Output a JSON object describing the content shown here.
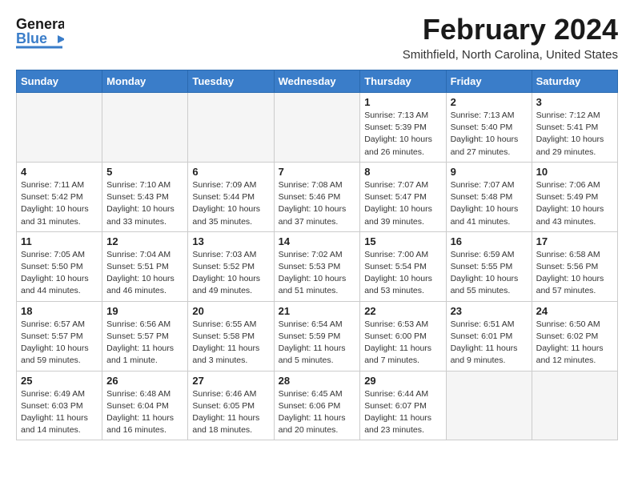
{
  "header": {
    "logo_line1": "General",
    "logo_line2": "Blue",
    "main_title": "February 2024",
    "subtitle": "Smithfield, North Carolina, United States"
  },
  "calendar": {
    "days_of_week": [
      "Sunday",
      "Monday",
      "Tuesday",
      "Wednesday",
      "Thursday",
      "Friday",
      "Saturday"
    ],
    "weeks": [
      [
        {
          "num": "",
          "info": ""
        },
        {
          "num": "",
          "info": ""
        },
        {
          "num": "",
          "info": ""
        },
        {
          "num": "",
          "info": ""
        },
        {
          "num": "1",
          "info": "Sunrise: 7:13 AM\nSunset: 5:39 PM\nDaylight: 10 hours\nand 26 minutes."
        },
        {
          "num": "2",
          "info": "Sunrise: 7:13 AM\nSunset: 5:40 PM\nDaylight: 10 hours\nand 27 minutes."
        },
        {
          "num": "3",
          "info": "Sunrise: 7:12 AM\nSunset: 5:41 PM\nDaylight: 10 hours\nand 29 minutes."
        }
      ],
      [
        {
          "num": "4",
          "info": "Sunrise: 7:11 AM\nSunset: 5:42 PM\nDaylight: 10 hours\nand 31 minutes."
        },
        {
          "num": "5",
          "info": "Sunrise: 7:10 AM\nSunset: 5:43 PM\nDaylight: 10 hours\nand 33 minutes."
        },
        {
          "num": "6",
          "info": "Sunrise: 7:09 AM\nSunset: 5:44 PM\nDaylight: 10 hours\nand 35 minutes."
        },
        {
          "num": "7",
          "info": "Sunrise: 7:08 AM\nSunset: 5:46 PM\nDaylight: 10 hours\nand 37 minutes."
        },
        {
          "num": "8",
          "info": "Sunrise: 7:07 AM\nSunset: 5:47 PM\nDaylight: 10 hours\nand 39 minutes."
        },
        {
          "num": "9",
          "info": "Sunrise: 7:07 AM\nSunset: 5:48 PM\nDaylight: 10 hours\nand 41 minutes."
        },
        {
          "num": "10",
          "info": "Sunrise: 7:06 AM\nSunset: 5:49 PM\nDaylight: 10 hours\nand 43 minutes."
        }
      ],
      [
        {
          "num": "11",
          "info": "Sunrise: 7:05 AM\nSunset: 5:50 PM\nDaylight: 10 hours\nand 44 minutes."
        },
        {
          "num": "12",
          "info": "Sunrise: 7:04 AM\nSunset: 5:51 PM\nDaylight: 10 hours\nand 46 minutes."
        },
        {
          "num": "13",
          "info": "Sunrise: 7:03 AM\nSunset: 5:52 PM\nDaylight: 10 hours\nand 49 minutes."
        },
        {
          "num": "14",
          "info": "Sunrise: 7:02 AM\nSunset: 5:53 PM\nDaylight: 10 hours\nand 51 minutes."
        },
        {
          "num": "15",
          "info": "Sunrise: 7:00 AM\nSunset: 5:54 PM\nDaylight: 10 hours\nand 53 minutes."
        },
        {
          "num": "16",
          "info": "Sunrise: 6:59 AM\nSunset: 5:55 PM\nDaylight: 10 hours\nand 55 minutes."
        },
        {
          "num": "17",
          "info": "Sunrise: 6:58 AM\nSunset: 5:56 PM\nDaylight: 10 hours\nand 57 minutes."
        }
      ],
      [
        {
          "num": "18",
          "info": "Sunrise: 6:57 AM\nSunset: 5:57 PM\nDaylight: 10 hours\nand 59 minutes."
        },
        {
          "num": "19",
          "info": "Sunrise: 6:56 AM\nSunset: 5:57 PM\nDaylight: 11 hours\nand 1 minute."
        },
        {
          "num": "20",
          "info": "Sunrise: 6:55 AM\nSunset: 5:58 PM\nDaylight: 11 hours\nand 3 minutes."
        },
        {
          "num": "21",
          "info": "Sunrise: 6:54 AM\nSunset: 5:59 PM\nDaylight: 11 hours\nand 5 minutes."
        },
        {
          "num": "22",
          "info": "Sunrise: 6:53 AM\nSunset: 6:00 PM\nDaylight: 11 hours\nand 7 minutes."
        },
        {
          "num": "23",
          "info": "Sunrise: 6:51 AM\nSunset: 6:01 PM\nDaylight: 11 hours\nand 9 minutes."
        },
        {
          "num": "24",
          "info": "Sunrise: 6:50 AM\nSunset: 6:02 PM\nDaylight: 11 hours\nand 12 minutes."
        }
      ],
      [
        {
          "num": "25",
          "info": "Sunrise: 6:49 AM\nSunset: 6:03 PM\nDaylight: 11 hours\nand 14 minutes."
        },
        {
          "num": "26",
          "info": "Sunrise: 6:48 AM\nSunset: 6:04 PM\nDaylight: 11 hours\nand 16 minutes."
        },
        {
          "num": "27",
          "info": "Sunrise: 6:46 AM\nSunset: 6:05 PM\nDaylight: 11 hours\nand 18 minutes."
        },
        {
          "num": "28",
          "info": "Sunrise: 6:45 AM\nSunset: 6:06 PM\nDaylight: 11 hours\nand 20 minutes."
        },
        {
          "num": "29",
          "info": "Sunrise: 6:44 AM\nSunset: 6:07 PM\nDaylight: 11 hours\nand 23 minutes."
        },
        {
          "num": "",
          "info": ""
        },
        {
          "num": "",
          "info": ""
        }
      ]
    ]
  }
}
